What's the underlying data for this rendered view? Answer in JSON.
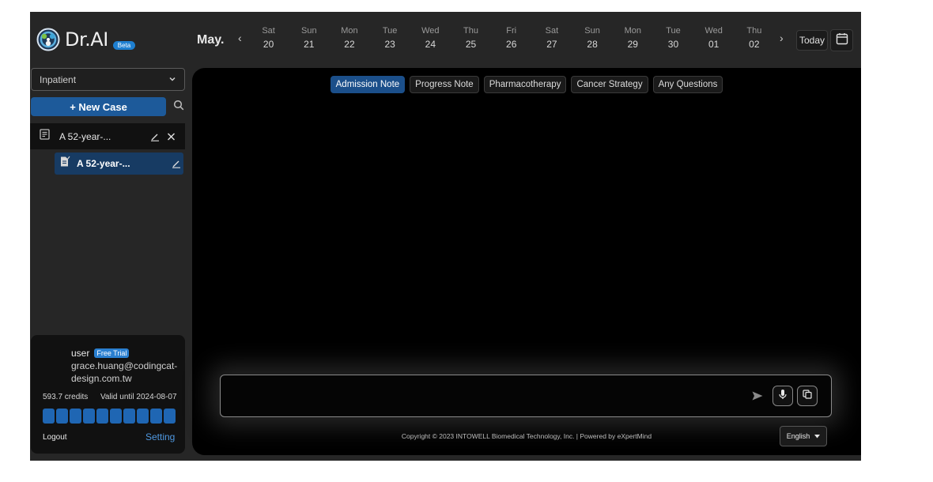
{
  "brand": {
    "name": "Dr.AI",
    "badge": "Beta"
  },
  "calendar": {
    "month": "May.",
    "prev_icon": "chevron-left-icon",
    "next_icon": "chevron-right-icon",
    "days": [
      {
        "dow": "Sat",
        "num": "20"
      },
      {
        "dow": "Sun",
        "num": "21"
      },
      {
        "dow": "Mon",
        "num": "22"
      },
      {
        "dow": "Tue",
        "num": "23"
      },
      {
        "dow": "Wed",
        "num": "24"
      },
      {
        "dow": "Thu",
        "num": "25"
      },
      {
        "dow": "Fri",
        "num": "26"
      },
      {
        "dow": "Sat",
        "num": "27"
      },
      {
        "dow": "Sun",
        "num": "28"
      },
      {
        "dow": "Mon",
        "num": "29"
      },
      {
        "dow": "Tue",
        "num": "30"
      },
      {
        "dow": "Wed",
        "num": "01"
      },
      {
        "dow": "Thu",
        "num": "02"
      }
    ],
    "today_label": "Today"
  },
  "sidebar": {
    "select_value": "Inpatient",
    "new_case_label": "+ New Case",
    "cases": [
      {
        "label": "A 52-year-...",
        "children": [
          {
            "label": "A 52-year-..."
          }
        ]
      }
    ]
  },
  "user": {
    "name": "user",
    "plan": "Free Trial",
    "email": "grace.huang@codingcat-design.com.tw",
    "credits": "593.7 credits",
    "valid_until": "Valid until 2024-08-07",
    "credit_blocks_total": 10,
    "credit_blocks_filled": 10,
    "logout_label": "Logout",
    "setting_label": "Setting"
  },
  "tabs": [
    {
      "label": "Admission Note",
      "active": true
    },
    {
      "label": "Progress Note",
      "active": false
    },
    {
      "label": "Pharmacotherapy",
      "active": false
    },
    {
      "label": "Cancer Strategy",
      "active": false
    },
    {
      "label": "Any Questions",
      "active": false
    }
  ],
  "composer": {
    "value": "",
    "placeholder": ""
  },
  "footer": {
    "copyright": "Copyright © 2023 INTOWELL Biomedical Technology, Inc. | Powered by eXpertMind",
    "language": "English"
  },
  "colors": {
    "accent": "#1d5a9a",
    "app_bg": "#262626",
    "main_bg": "#000000",
    "link": "#4f98e0"
  }
}
